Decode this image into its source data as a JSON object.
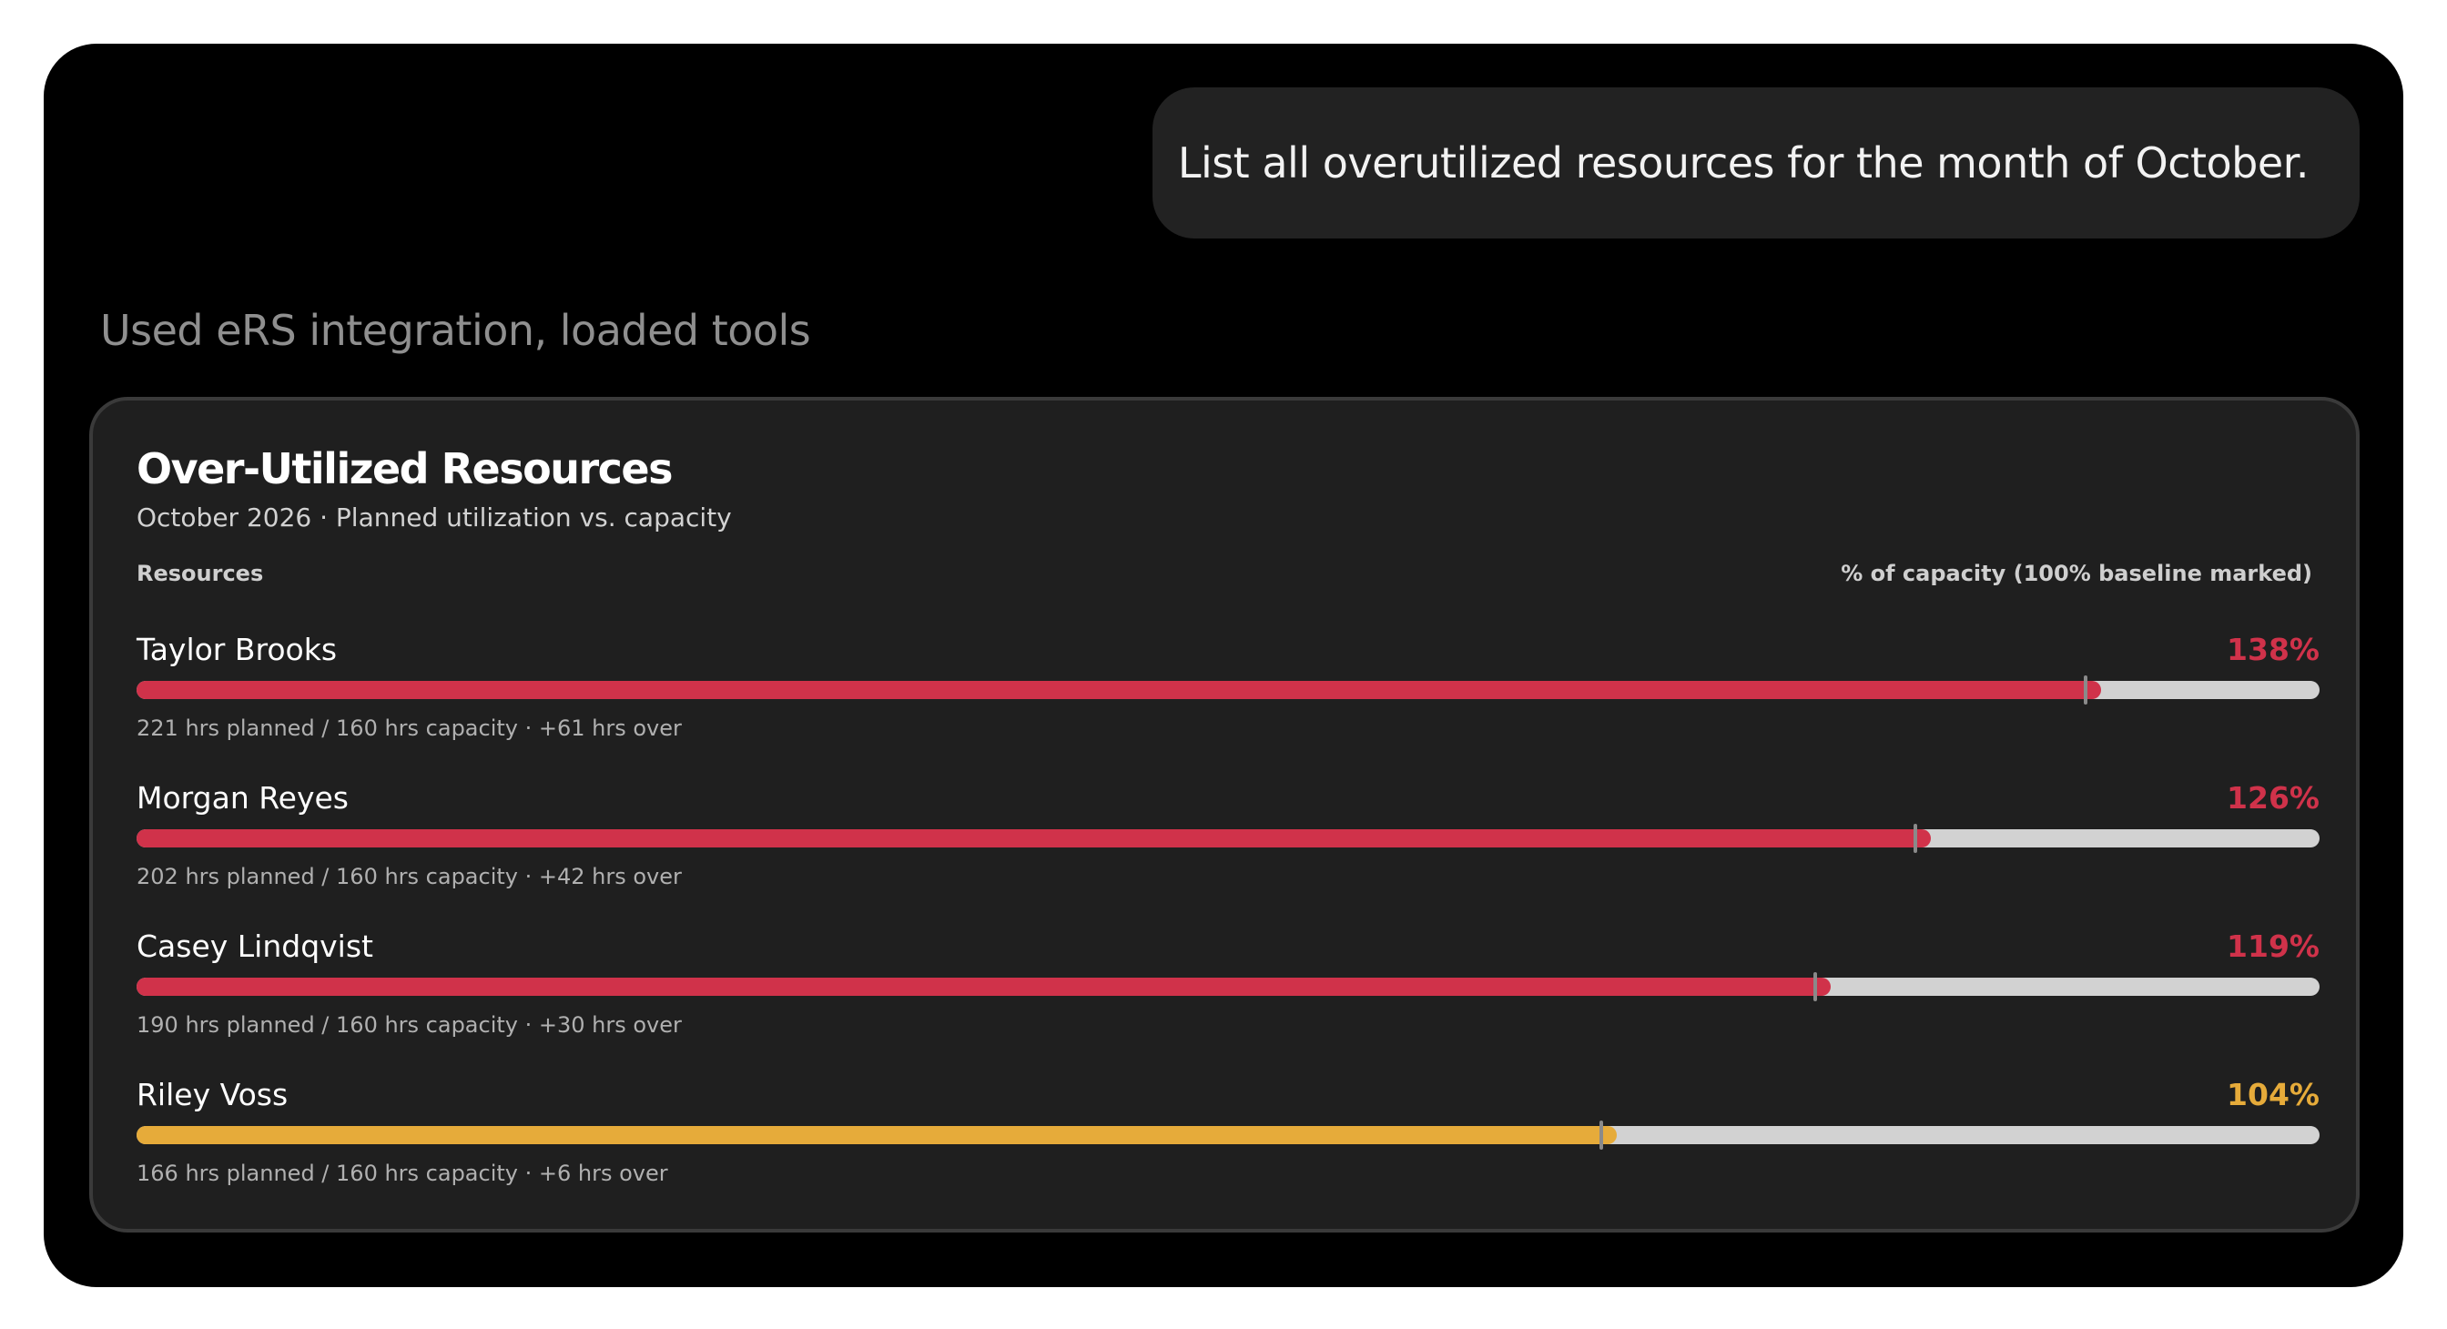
{
  "prompt": "List all overutilized resources for the month of October.",
  "tool_status": "Used eRS integration, loaded tools",
  "card": {
    "title": "Over-Utilized Resources",
    "subtitle": "October 2026 · Planned utilization vs. capacity",
    "col_resources": "Resources",
    "col_capacity": "% of capacity (100% baseline marked)"
  },
  "colors": {
    "over": "#d0324a",
    "warning": "#e6ab3a",
    "track": "#d2d2d2",
    "card_bg": "#1f1f1f"
  },
  "chart_data": {
    "type": "bar",
    "orientation": "horizontal",
    "baseline_percent": 100,
    "max_percent": 138,
    "rows": [
      {
        "name": "Taylor Brooks",
        "percent": 138,
        "percent_label": "138%",
        "planned_hrs": 221,
        "capacity_hrs": 160,
        "over_hrs": 61,
        "detail": "221 hrs planned / 160 hrs capacity · +61 hrs over",
        "color": "#d0324a"
      },
      {
        "name": "Morgan Reyes",
        "percent": 126,
        "percent_label": "126%",
        "planned_hrs": 202,
        "capacity_hrs": 160,
        "over_hrs": 42,
        "detail": "202 hrs planned / 160 hrs capacity · +42 hrs over",
        "color": "#d0324a"
      },
      {
        "name": "Casey Lindqvist",
        "percent": 119,
        "percent_label": "119%",
        "planned_hrs": 190,
        "capacity_hrs": 160,
        "over_hrs": 30,
        "detail": "190 hrs planned / 160 hrs capacity · +30 hrs over",
        "color": "#d0324a"
      },
      {
        "name": "Riley Voss",
        "percent": 104,
        "percent_label": "104%",
        "planned_hrs": 166,
        "capacity_hrs": 160,
        "over_hrs": 6,
        "detail": "166 hrs planned / 160 hrs capacity · +6 hrs over",
        "color": "#e6ab3a"
      }
    ]
  }
}
